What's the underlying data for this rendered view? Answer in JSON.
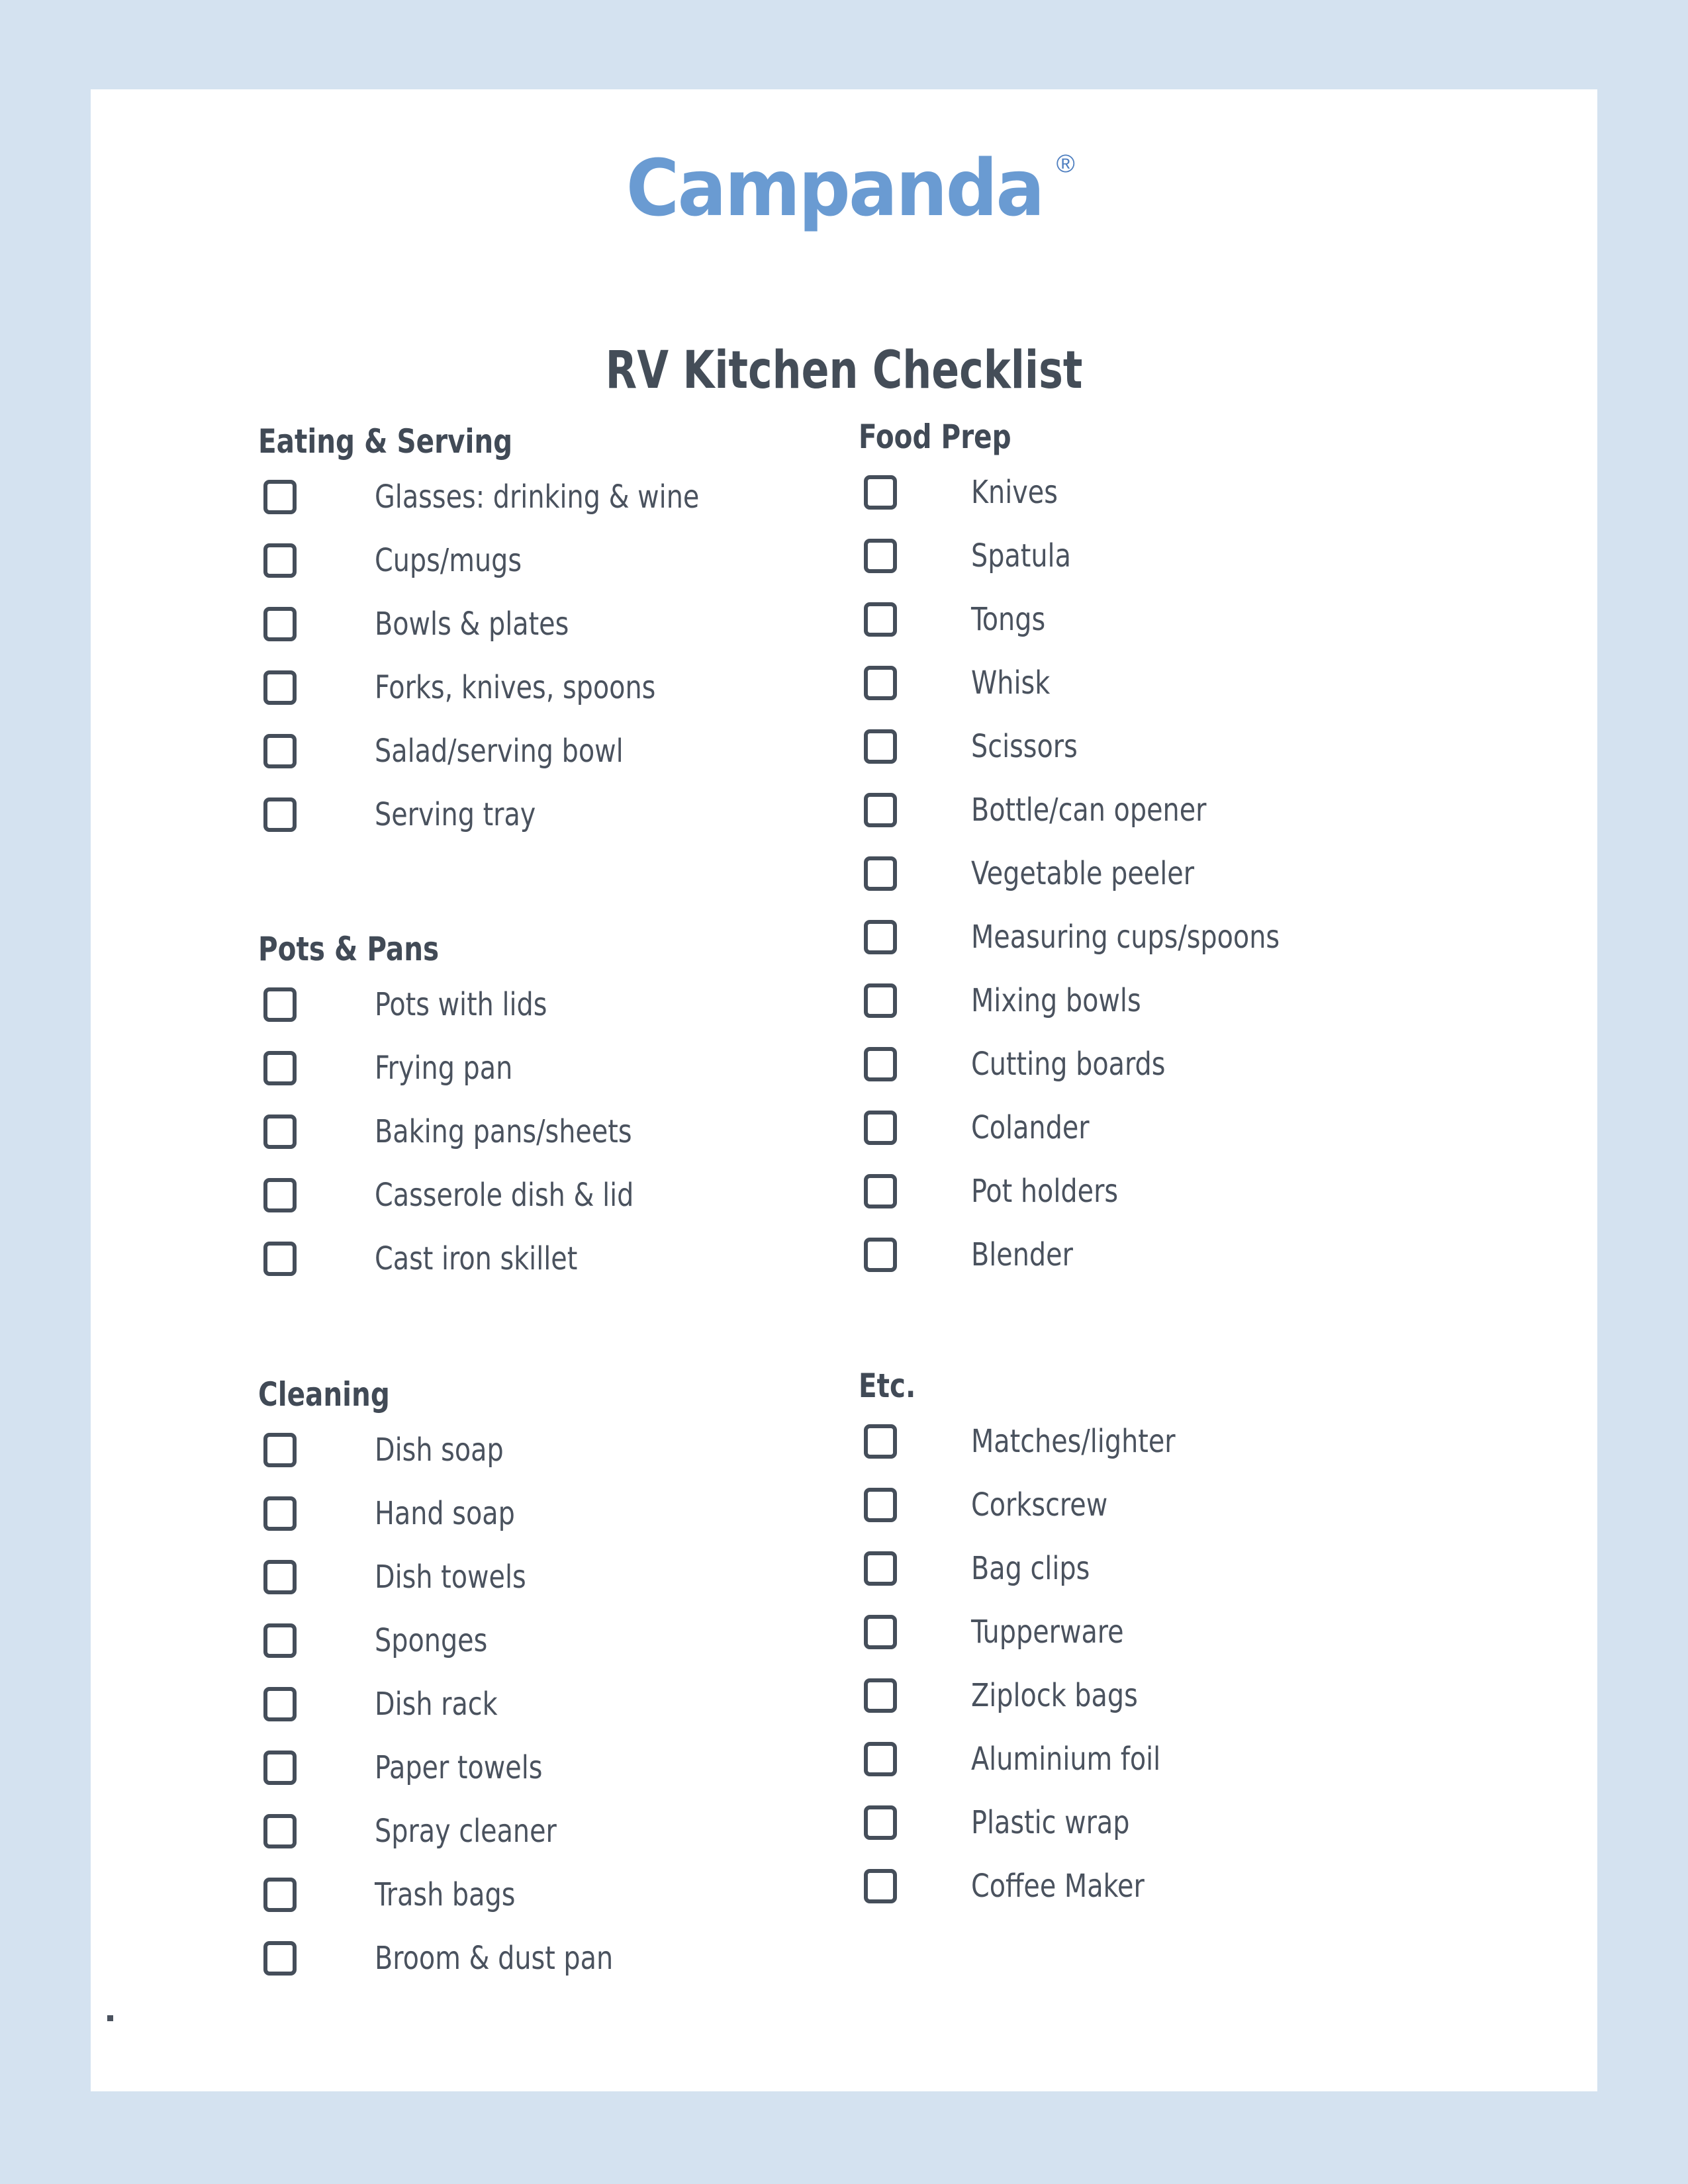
{
  "header": {
    "logo_text": "Campanda",
    "logo_trademark": "®",
    "title": "RV Kitchen Checklist",
    "logo_color": "#6a9bd2",
    "title_color": "#444d58"
  },
  "page": {
    "background_color": "#d4e2f0",
    "sheet_color": "#ffffff",
    "footnote": "."
  },
  "sections": {
    "eating": {
      "title": "Eating & Serving",
      "items": [
        {
          "label": "Glasses: drinking & wine",
          "checked": false
        },
        {
          "label": "Cups/mugs",
          "checked": false
        },
        {
          "label": "Bowls & plates",
          "checked": false
        },
        {
          "label": "Forks, knives, spoons",
          "checked": false
        },
        {
          "label": "Salad/serving bowl",
          "checked": false
        },
        {
          "label": "Serving tray",
          "checked": false
        }
      ]
    },
    "pots": {
      "title": "Pots & Pans",
      "items": [
        {
          "label": "Pots with lids",
          "checked": false
        },
        {
          "label": "Frying pan",
          "checked": false
        },
        {
          "label": "Baking pans/sheets",
          "checked": false
        },
        {
          "label": "Casserole dish & lid",
          "checked": false
        },
        {
          "label": "Cast iron skillet",
          "checked": false
        }
      ]
    },
    "cleaning": {
      "title": "Cleaning",
      "items": [
        {
          "label": "Dish soap",
          "checked": false
        },
        {
          "label": "Hand soap",
          "checked": false
        },
        {
          "label": "Dish towels",
          "checked": false
        },
        {
          "label": "Sponges",
          "checked": false
        },
        {
          "label": "Dish rack",
          "checked": false
        },
        {
          "label": "Paper towels",
          "checked": false
        },
        {
          "label": "Spray cleaner",
          "checked": false
        },
        {
          "label": "Trash bags",
          "checked": false
        },
        {
          "label": "Broom & dust pan",
          "checked": false
        }
      ]
    },
    "food_prep": {
      "title": "Food Prep",
      "items": [
        {
          "label": "Knives",
          "checked": false
        },
        {
          "label": "Spatula",
          "checked": false
        },
        {
          "label": "Tongs",
          "checked": false
        },
        {
          "label": "Whisk",
          "checked": false
        },
        {
          "label": "Scissors",
          "checked": false
        },
        {
          "label": "Bottle/can opener",
          "checked": false
        },
        {
          "label": "Vegetable peeler",
          "checked": false
        },
        {
          "label": "Measuring cups/spoons",
          "checked": false
        },
        {
          "label": "Mixing bowls",
          "checked": false
        },
        {
          "label": "Cutting boards",
          "checked": false
        },
        {
          "label": "Colander",
          "checked": false
        },
        {
          "label": "Pot holders",
          "checked": false
        },
        {
          "label": "Blender",
          "checked": false
        }
      ]
    },
    "etc": {
      "title": "Etc.",
      "items": [
        {
          "label": "Matches/lighter",
          "checked": false
        },
        {
          "label": "Corkscrew",
          "checked": false
        },
        {
          "label": "Bag clips",
          "checked": false
        },
        {
          "label": "Tupperware",
          "checked": false
        },
        {
          "label": "Ziplock bags",
          "checked": false
        },
        {
          "label": "Aluminium foil",
          "checked": false
        },
        {
          "label": "Plastic wrap",
          "checked": false
        },
        {
          "label": "Coffee Maker",
          "checked": false
        }
      ]
    }
  }
}
